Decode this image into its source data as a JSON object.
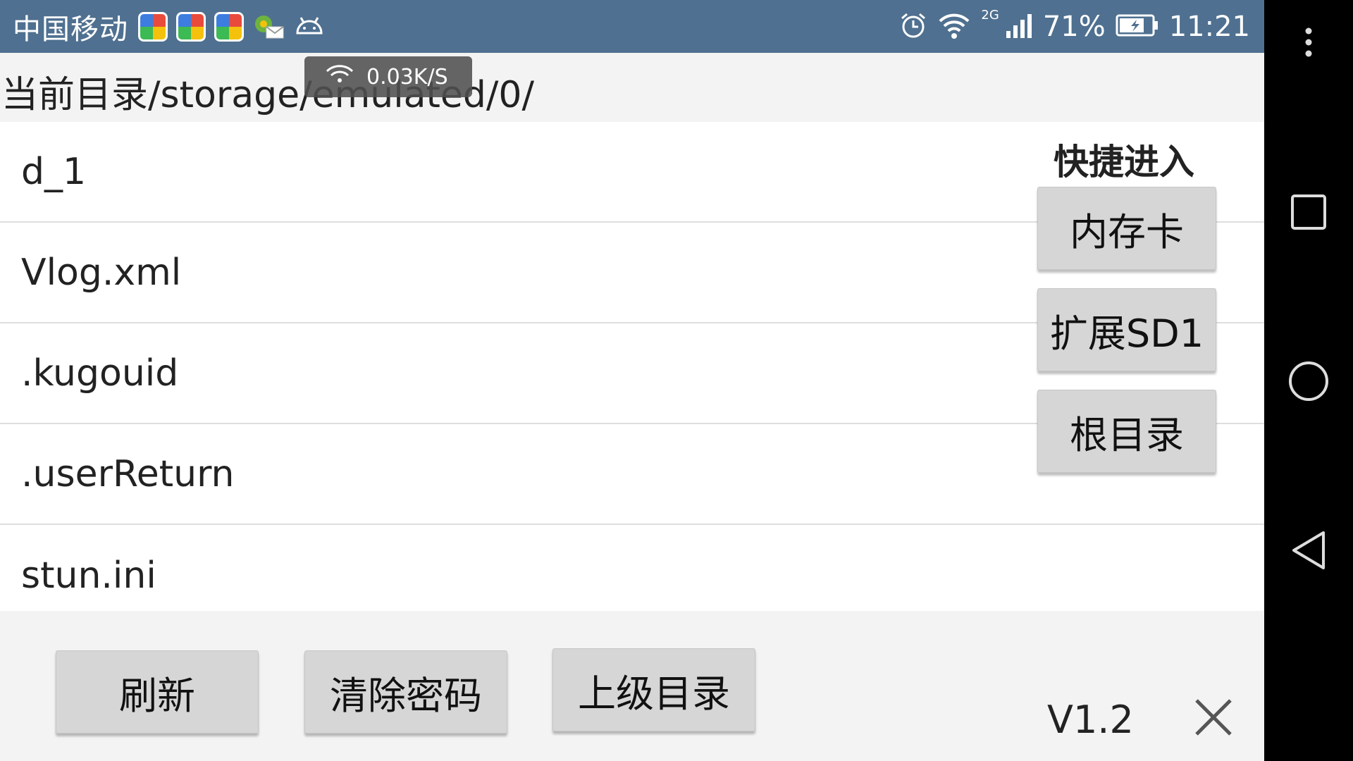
{
  "status_bar": {
    "carrier": "中国移动",
    "network_type": "2G",
    "battery": "71%",
    "time": "11:21",
    "icons": [
      "app-icon",
      "app-icon",
      "app-icon",
      "notification-icon",
      "android-icon",
      "alarm-icon",
      "wifi-icon",
      "signal-icon",
      "battery-icon"
    ]
  },
  "speed_toast": {
    "text": "0.03K/S"
  },
  "current_dir": {
    "label": "当前目录",
    "path": "/storage/emulated/0/"
  },
  "files": [
    {
      "name": "d_1"
    },
    {
      "name": "Vlog.xml"
    },
    {
      "name": ".kugouid"
    },
    {
      "name": ".userReturn"
    },
    {
      "name": "stun.ini"
    }
  ],
  "quick_access": {
    "title": "快捷进入",
    "buttons": [
      {
        "label": "内存卡"
      },
      {
        "label": "扩展SD1"
      },
      {
        "label": "根目录"
      }
    ]
  },
  "bottom_bar": {
    "refresh": "刷新",
    "clear_password": "清除密码",
    "parent_dir": "上级目录",
    "version": "V1.2"
  },
  "colors": {
    "status_bar_bg": "#4f7090",
    "button_bg": "#d6d6d6",
    "page_bg": "#f3f3f3"
  }
}
